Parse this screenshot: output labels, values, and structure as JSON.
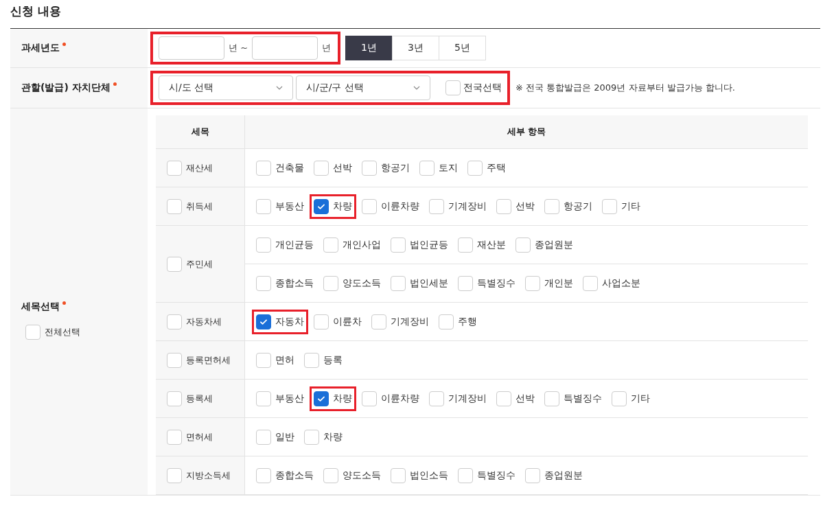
{
  "section_title": "신청 내용",
  "tax_year": {
    "label": "과세년도",
    "required": true,
    "highlighted": true,
    "unit_from": "년 ~",
    "unit_to": "년",
    "periods": [
      {
        "label": "1년",
        "selected": true
      },
      {
        "label": "3년",
        "selected": false
      },
      {
        "label": "5년",
        "selected": false
      }
    ]
  },
  "jurisdiction": {
    "label": "관할(발급) 자치단체",
    "required": true,
    "highlighted": true,
    "selects": [
      {
        "value": "시/도 선택"
      },
      {
        "value": "시/군/구 선택"
      }
    ],
    "nationwide": {
      "label": "전국선택",
      "checked": false
    },
    "note": "※ 전국 통합발급은 2009년 자료부터 발급가능 합니다."
  },
  "tax_items": {
    "label": "세목선택",
    "required": true,
    "select_all": {
      "label": "전체선택",
      "checked": false
    },
    "columns": [
      "세목",
      "세부 항목"
    ],
    "rows": [
      {
        "name": "재산세",
        "checked": false,
        "lines": [
          [
            {
              "label": "건축물",
              "checked": false,
              "highlighted": false
            },
            {
              "label": "선박",
              "checked": false,
              "highlighted": false
            },
            {
              "label": "항공기",
              "checked": false,
              "highlighted": false
            },
            {
              "label": "토지",
              "checked": false,
              "highlighted": false
            },
            {
              "label": "주택",
              "checked": false,
              "highlighted": false
            }
          ]
        ]
      },
      {
        "name": "취득세",
        "checked": false,
        "lines": [
          [
            {
              "label": "부동산",
              "checked": false,
              "highlighted": false
            },
            {
              "label": "차량",
              "checked": true,
              "highlighted": true
            },
            {
              "label": "이륜차량",
              "checked": false,
              "highlighted": false
            },
            {
              "label": "기계장비",
              "checked": false,
              "highlighted": false
            },
            {
              "label": "선박",
              "checked": false,
              "highlighted": false
            },
            {
              "label": "항공기",
              "checked": false,
              "highlighted": false
            },
            {
              "label": "기타",
              "checked": false,
              "highlighted": false
            }
          ]
        ]
      },
      {
        "name": "주민세",
        "checked": false,
        "lines": [
          [
            {
              "label": "개인균등",
              "checked": false,
              "highlighted": false
            },
            {
              "label": "개인사업",
              "checked": false,
              "highlighted": false
            },
            {
              "label": "법인균등",
              "checked": false,
              "highlighted": false
            },
            {
              "label": "재산분",
              "checked": false,
              "highlighted": false
            },
            {
              "label": "종업원분",
              "checked": false,
              "highlighted": false
            }
          ],
          [
            {
              "label": "종합소득",
              "checked": false,
              "highlighted": false
            },
            {
              "label": "양도소득",
              "checked": false,
              "highlighted": false
            },
            {
              "label": "법인세분",
              "checked": false,
              "highlighted": false
            },
            {
              "label": "특별징수",
              "checked": false,
              "highlighted": false
            },
            {
              "label": "개인분",
              "checked": false,
              "highlighted": false
            },
            {
              "label": "사업소분",
              "checked": false,
              "highlighted": false
            }
          ]
        ]
      },
      {
        "name": "자동차세",
        "checked": false,
        "lines": [
          [
            {
              "label": "자동차",
              "checked": true,
              "highlighted": true
            },
            {
              "label": "이륜차",
              "checked": false,
              "highlighted": false
            },
            {
              "label": "기계장비",
              "checked": false,
              "highlighted": false
            },
            {
              "label": "주행",
              "checked": false,
              "highlighted": false
            }
          ]
        ]
      },
      {
        "name": "등록면허세",
        "checked": false,
        "lines": [
          [
            {
              "label": "면허",
              "checked": false,
              "highlighted": false
            },
            {
              "label": "등록",
              "checked": false,
              "highlighted": false
            }
          ]
        ]
      },
      {
        "name": "등록세",
        "checked": false,
        "lines": [
          [
            {
              "label": "부동산",
              "checked": false,
              "highlighted": false
            },
            {
              "label": "차량",
              "checked": true,
              "highlighted": true
            },
            {
              "label": "이륜차량",
              "checked": false,
              "highlighted": false
            },
            {
              "label": "기계장비",
              "checked": false,
              "highlighted": false
            },
            {
              "label": "선박",
              "checked": false,
              "highlighted": false
            },
            {
              "label": "특별징수",
              "checked": false,
              "highlighted": false
            },
            {
              "label": "기타",
              "checked": false,
              "highlighted": false
            }
          ]
        ]
      },
      {
        "name": "면허세",
        "checked": false,
        "lines": [
          [
            {
              "label": "일반",
              "checked": false,
              "highlighted": false
            },
            {
              "label": "차량",
              "checked": false,
              "highlighted": false
            }
          ]
        ]
      },
      {
        "name": "지방소득세",
        "checked": false,
        "lines": [
          [
            {
              "label": "종합소득",
              "checked": false,
              "highlighted": false
            },
            {
              "label": "양도소득",
              "checked": false,
              "highlighted": false
            },
            {
              "label": "법인소득",
              "checked": false,
              "highlighted": false
            },
            {
              "label": "특별징수",
              "checked": false,
              "highlighted": false
            },
            {
              "label": "종업원분",
              "checked": false,
              "highlighted": false
            }
          ]
        ]
      }
    ]
  }
}
